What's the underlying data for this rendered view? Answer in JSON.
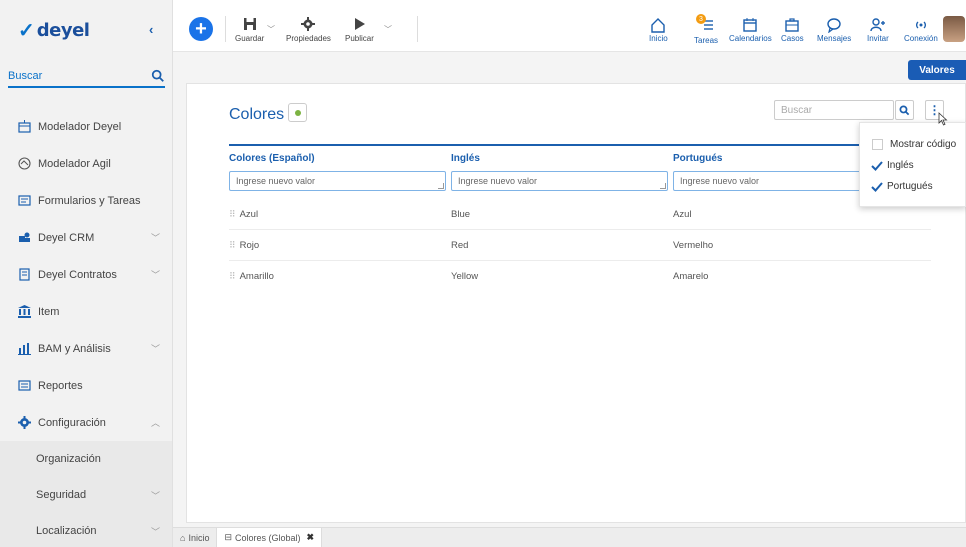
{
  "app": {
    "logo_text": "deyel"
  },
  "sidebar": {
    "search_placeholder": "Buscar",
    "items": [
      {
        "label": "Modelador Deyel",
        "has_chevron": false
      },
      {
        "label": "Modelador Agil",
        "has_chevron": false
      },
      {
        "label": "Formularios y Tareas",
        "has_chevron": false
      },
      {
        "label": "Deyel CRM",
        "has_chevron": true
      },
      {
        "label": "Deyel Contratos",
        "has_chevron": true
      },
      {
        "label": "Item",
        "has_chevron": false
      },
      {
        "label": "BAM y Análisis",
        "has_chevron": true
      },
      {
        "label": "Reportes",
        "has_chevron": false
      },
      {
        "label": "Configuración",
        "has_chevron": true,
        "expanded": true
      }
    ],
    "sub_items": [
      {
        "label": "Organización",
        "has_chevron": false
      },
      {
        "label": "Seguridad",
        "has_chevron": true
      },
      {
        "label": "Localización",
        "has_chevron": true
      }
    ]
  },
  "toolbar": {
    "left": [
      {
        "label": "Guardar"
      },
      {
        "label": "Propiedades"
      },
      {
        "label": "Publicar"
      }
    ],
    "right": [
      {
        "label": "Inicio"
      },
      {
        "label": "Tareas",
        "badge": "3"
      },
      {
        "label": "Calendarios"
      },
      {
        "label": "Casos"
      },
      {
        "label": "Mensajes"
      },
      {
        "label": "Invitar"
      },
      {
        "label": "Conexión"
      }
    ]
  },
  "main": {
    "valores_button": "Valores",
    "panel_title": "Colores",
    "search_placeholder": "Buscar",
    "table": {
      "headers": [
        "Colores (Español)",
        "Inglés",
        "Portugués"
      ],
      "input_placeholder": "Ingrese nuevo valor",
      "rows": [
        [
          "Azul",
          "Blue",
          "Azul"
        ],
        [
          "Rojo",
          "Red",
          "Vermelho"
        ],
        [
          "Amarillo",
          "Yellow",
          "Amarelo"
        ]
      ]
    },
    "dropdown": [
      {
        "label": "Mostrar código",
        "checked": false
      },
      {
        "label": "Inglés",
        "checked": true
      },
      {
        "label": "Portugués",
        "checked": true
      }
    ]
  },
  "bottom_tabs": [
    {
      "label": "Inicio"
    },
    {
      "label": "Colores (Global)"
    }
  ],
  "colors": {
    "accent": "#1b5fae",
    "primary_button": "#1a73e8",
    "status_dot": "#7cb342",
    "badge": "#f39c12"
  }
}
